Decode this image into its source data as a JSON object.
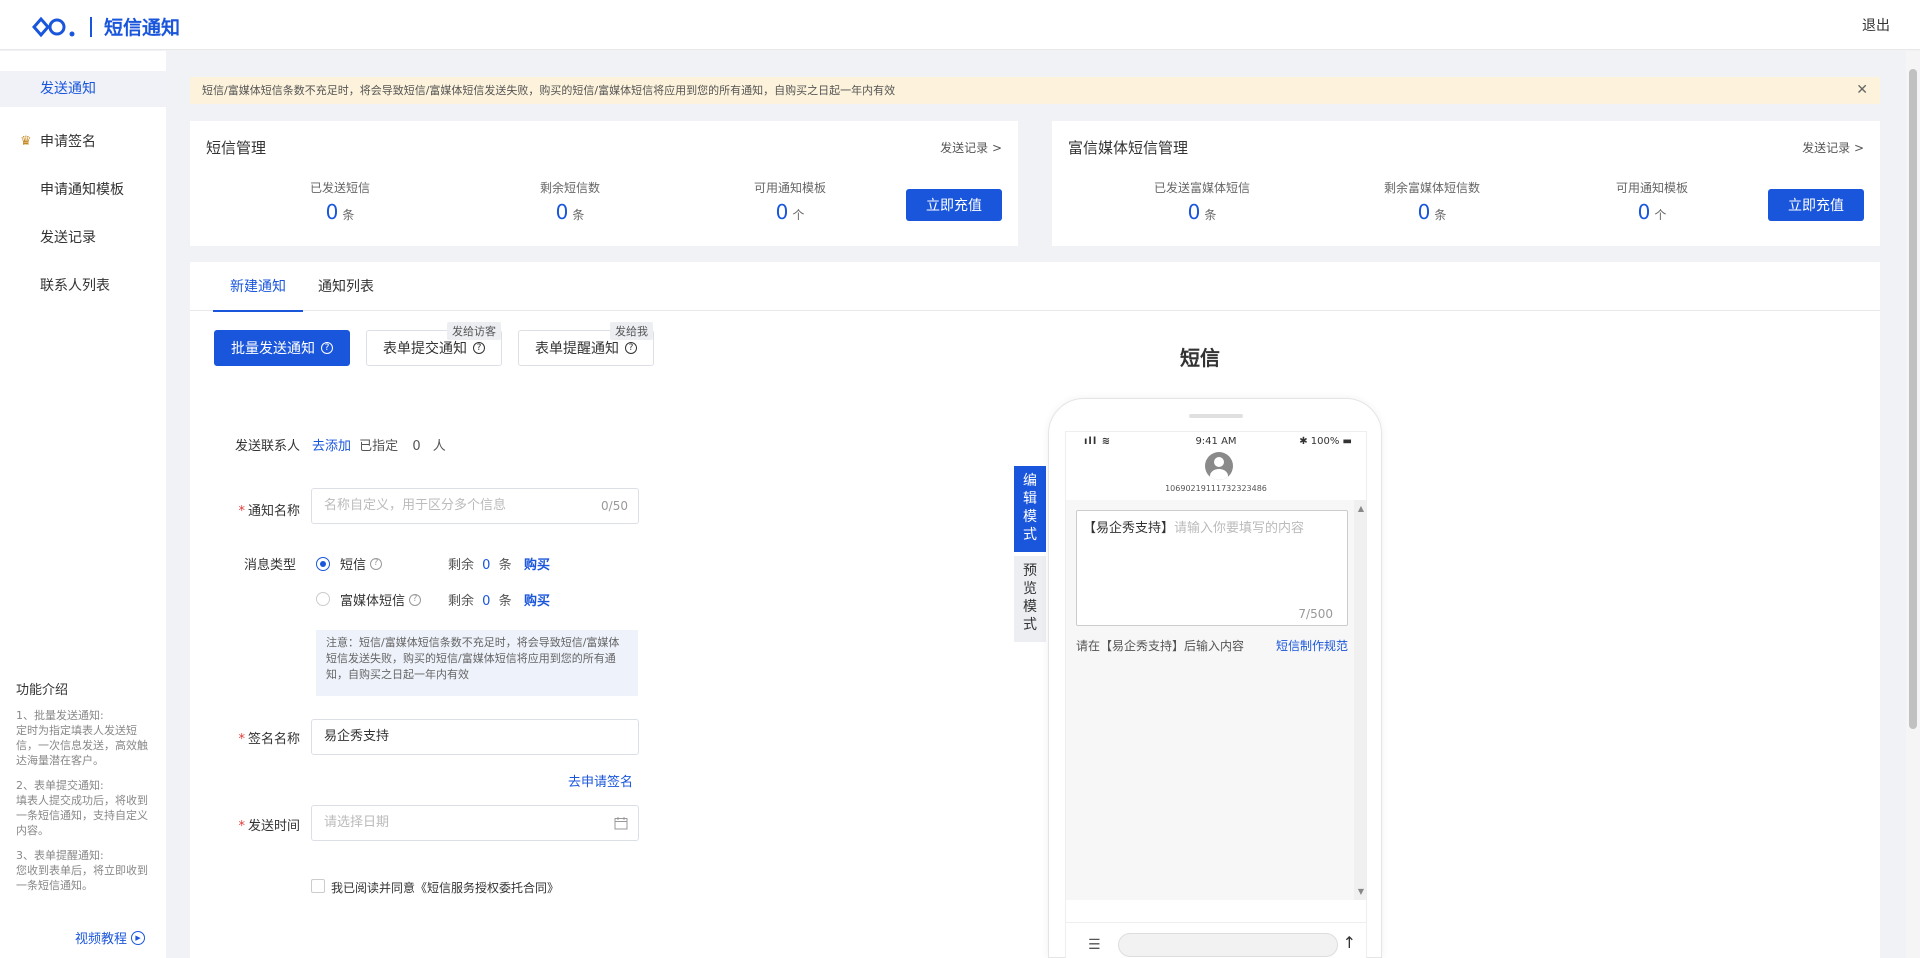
{
  "header": {
    "app_title": "短信通知",
    "logout_label": "退出"
  },
  "sidebar": {
    "items": [
      {
        "label": "发送通知"
      },
      {
        "label": "申请签名"
      },
      {
        "label": "申请通知模板"
      },
      {
        "label": "发送记录"
      },
      {
        "label": "联系人列表"
      }
    ],
    "intro_title": "功能介绍",
    "intro_blocks": [
      {
        "title": "1、批量发送通知:",
        "text": "定时为指定填表人发送短信，一次信息发送，高效触达海量潜在客户。"
      },
      {
        "title": "2、表单提交通知:",
        "text": "填表人提交成功后，将收到一条短信通知，支持自定义内容。"
      },
      {
        "title": "3、表单提醒通知:",
        "text": "您收到表单后，将立即收到一条短信通知。"
      }
    ],
    "video_label": "视频教程"
  },
  "notice": {
    "text": "短信/富媒体短信条数不充足时，将会导致短信/富媒体短信发送失败，购买的短信/富媒体短信将应用到您的所有通知，自购买之日起一年内有效"
  },
  "sms_card": {
    "title": "短信管理",
    "link": "发送记录 >",
    "stats": [
      {
        "label": "已发送短信",
        "value": "0",
        "unit": "条"
      },
      {
        "label": "剩余短信数",
        "value": "0",
        "unit": "条"
      },
      {
        "label": "可用通知模板",
        "value": "0",
        "unit": "个"
      }
    ],
    "button": "立即充值"
  },
  "rich_card": {
    "title": "富信媒体短信管理",
    "link": "发送记录 >",
    "stats": [
      {
        "label": "已发送富媒体短信",
        "value": "0",
        "unit": "条"
      },
      {
        "label": "剩余富媒体短信数",
        "value": "0",
        "unit": "条"
      },
      {
        "label": "可用通知模板",
        "value": "0",
        "unit": "个"
      }
    ],
    "button": "立即充值"
  },
  "tabs": [
    {
      "label": "新建通知",
      "active": true
    },
    {
      "label": "通知列表",
      "active": false
    }
  ],
  "notify_types": [
    {
      "label": "批量发送通知",
      "tag": ""
    },
    {
      "label": "表单提交通知",
      "tag": "发给访客"
    },
    {
      "label": "表单提醒通知",
      "tag": "发给我"
    }
  ],
  "form": {
    "contacts_label": "发送联系人",
    "contacts_add": "去添加",
    "contacts_assigned": "已指定",
    "contacts_count": "0",
    "contacts_unit": "人",
    "name_label": "通知名称",
    "name_placeholder": "名称自定义，用于区分多个信息",
    "name_counter": "0/50",
    "msg_type_label": "消息类型",
    "msg_types": [
      {
        "label": "短信",
        "remain_prefix": "剩余",
        "remain": "0",
        "remain_unit": "条",
        "buy": "购买",
        "checked": true
      },
      {
        "label": "富媒体短信",
        "remain_prefix": "剩余",
        "remain": "0",
        "remain_unit": "条",
        "buy": "购买",
        "checked": false
      }
    ],
    "tip": "注意：短信/富媒体短信条数不充足时，将会导致短信/富媒体短信发送失败，购买的短信/富媒体短信将应用到您的所有通知，自购买之日起一年内有效",
    "sign_label": "签名名称",
    "sign_value": "易企秀支持",
    "sign_apply": "去申请签名",
    "time_label": "发送时间",
    "time_placeholder": "请选择日期",
    "agree_text": "我已阅读并同意《短信服务授权委托合同》"
  },
  "preview": {
    "title": "短信",
    "mode_edit": "编辑模式",
    "mode_preview": "预览模式",
    "status_time": "9:41 AM",
    "status_battery": "100%",
    "phone_number": "10690219111732323486",
    "sms_prefix": "【易企秀支持】",
    "sms_placeholder": "请输入你要填写的内容",
    "sms_counter": "7/500",
    "hint": "请在【易企秀支持】后输入内容",
    "rule_link": "短信制作规范"
  },
  "colors": {
    "accent": "#1a56db",
    "notice_bg": "#fdf3dc",
    "required": "#e53935"
  }
}
